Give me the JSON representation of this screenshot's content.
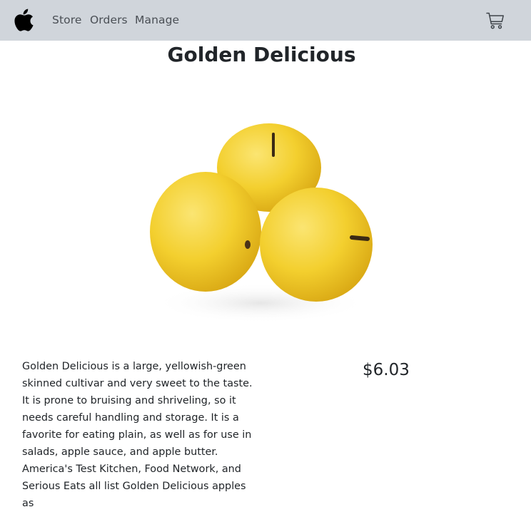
{
  "nav": {
    "logo_icon": "apple-logo-icon",
    "links": [
      "Store",
      "Orders",
      "Manage"
    ],
    "cart_icon": "cart-icon",
    "background": "#d0d5db"
  },
  "product": {
    "name": "Golden Delicious",
    "image_icon": "golden-apples-image",
    "description": "Golden Delicious is a large, yellowish-green skinned cultivar and very sweet to the taste. It is prone to bruising and shriveling, so it needs careful handling and storage. It is a favorite for eating plain, as well as for use in salads, apple sauce, and apple butter. America's Test Kitchen, Food Network, and Serious Eats all list Golden Delicious apples as",
    "price": "$6.03"
  }
}
